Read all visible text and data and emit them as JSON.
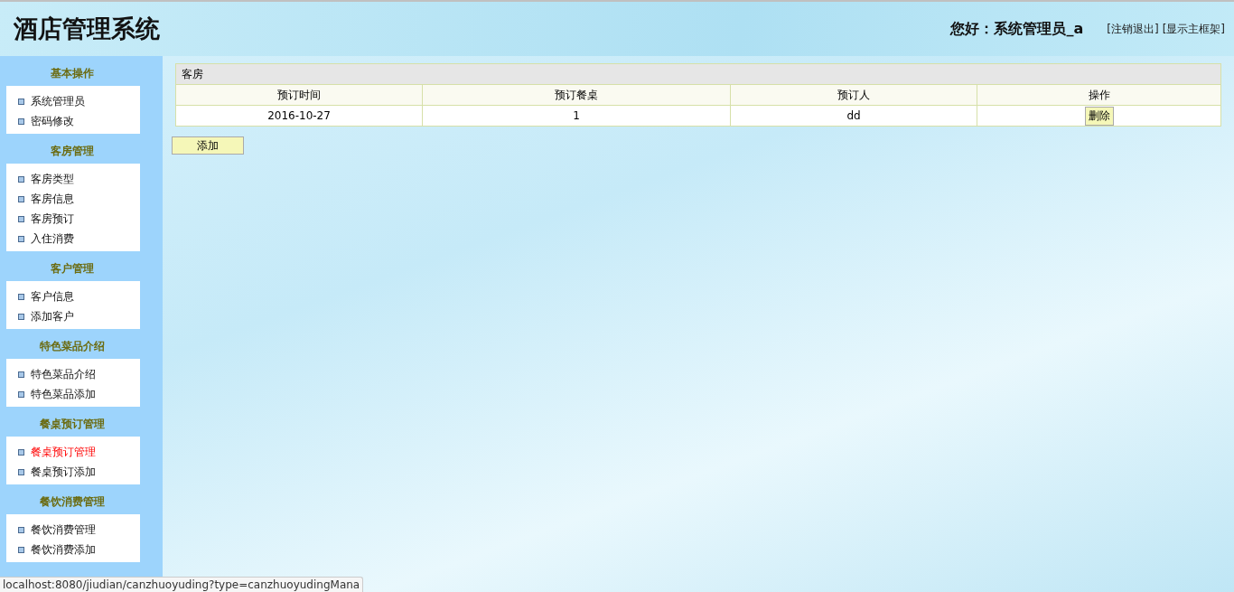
{
  "header": {
    "title": "酒店管理系统",
    "greeting": "您好：系统管理员_a",
    "links": [
      "[注销退出]",
      "[显示主框架]"
    ]
  },
  "sidebar": [
    {
      "title": "基本操作",
      "items": [
        {
          "label": "系统管理员",
          "selected": false
        },
        {
          "label": "密码修改",
          "selected": false
        }
      ]
    },
    {
      "title": "客房管理",
      "items": [
        {
          "label": "客房类型",
          "selected": false
        },
        {
          "label": "客房信息",
          "selected": false
        },
        {
          "label": "客房预订",
          "selected": false
        },
        {
          "label": "入住消费",
          "selected": false
        }
      ]
    },
    {
      "title": "客户管理",
      "items": [
        {
          "label": "客户信息",
          "selected": false
        },
        {
          "label": "添加客户",
          "selected": false
        }
      ]
    },
    {
      "title": "特色菜品介绍",
      "items": [
        {
          "label": "特色菜品介绍",
          "selected": false
        },
        {
          "label": "特色菜品添加",
          "selected": false
        }
      ]
    },
    {
      "title": "餐桌预订管理",
      "items": [
        {
          "label": "餐桌预订管理",
          "selected": true
        },
        {
          "label": "餐桌预订添加",
          "selected": false
        }
      ]
    },
    {
      "title": "餐饮消费管理",
      "items": [
        {
          "label": "餐饮消费管理",
          "selected": false
        },
        {
          "label": "餐饮消费添加",
          "selected": false
        }
      ]
    }
  ],
  "table": {
    "caption": "客房",
    "columns": [
      "预订时间",
      "预订餐桌",
      "预订人",
      "操作"
    ],
    "rows": [
      {
        "cells": [
          "2016-10-27",
          "1",
          "dd"
        ],
        "action": "删除"
      }
    ]
  },
  "add_button": "添加",
  "status_bar": "localhost:8080/jiudian/canzhuoyuding?type=canzhuoyudingMana"
}
